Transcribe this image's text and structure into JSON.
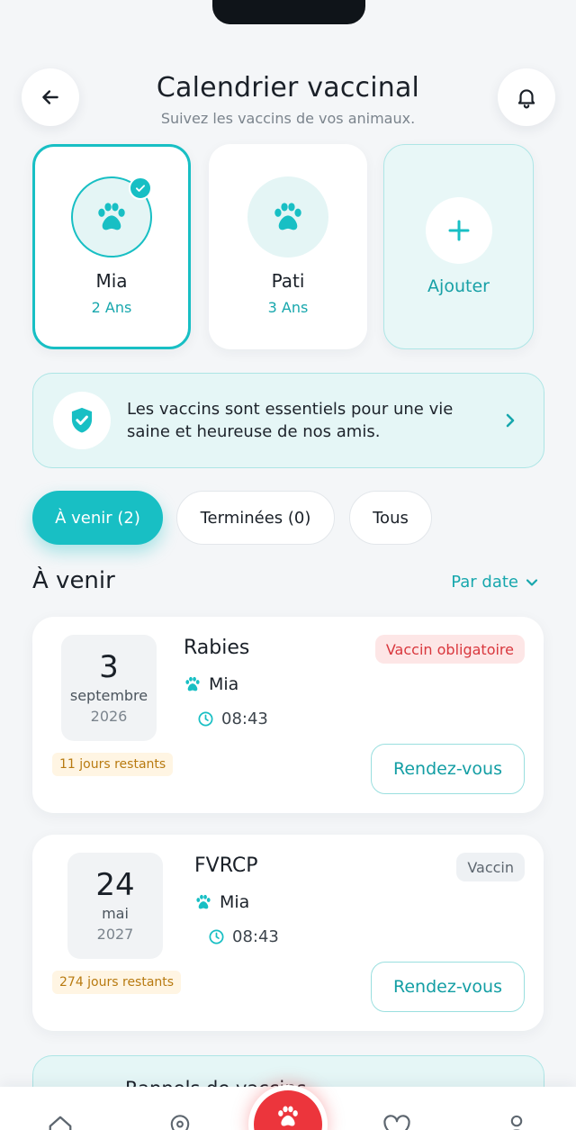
{
  "header": {
    "title": "Calendrier vaccinal",
    "subtitle": "Suivez les vaccins de vos animaux."
  },
  "pets": [
    {
      "name": "Mia",
      "age": "2 Ans",
      "selected": true
    },
    {
      "name": "Pati",
      "age": "3 Ans",
      "selected": false
    }
  ],
  "add_pet": {
    "label": "Ajouter"
  },
  "banner": {
    "text": "Les vaccins sont essentiels pour une vie saine et heureuse de nos amis."
  },
  "tabs": [
    {
      "label": "À venir (2)",
      "active": true
    },
    {
      "label": "Terminées (0)",
      "active": false
    },
    {
      "label": "Tous",
      "active": false
    }
  ],
  "section": {
    "title": "À venir",
    "sort_label": "Par date"
  },
  "vaccines": [
    {
      "day": "3",
      "month": "septembre",
      "year": "2026",
      "days_left": "11 jours restants",
      "name": "Rabies",
      "pet": "Mia",
      "time": "08:43",
      "badge": "Vaccin obligatoire",
      "badge_type": "required",
      "action": "Rendez-vous"
    },
    {
      "day": "24",
      "month": "mai",
      "year": "2027",
      "days_left": "274 jours restants",
      "name": "FVRCP",
      "pet": "Mia",
      "time": "08:43",
      "badge": "Vaccin",
      "badge_type": "normal",
      "action": "Rendez-vous"
    }
  ],
  "teaser": {
    "title": "Rappels de vaccins"
  },
  "icons": {
    "back": "arrow-left-icon",
    "notifications": "bell-icon",
    "pet": "paw-icon",
    "check": "check-icon",
    "add": "plus-icon",
    "shield": "shield-check-icon",
    "chevron": "chevron-right-icon",
    "sort": "chevron-down-icon",
    "time": "clock-icon",
    "nav_home": "home-icon",
    "nav_location": "location-pin-icon",
    "nav_favorites": "heart-icon",
    "nav_profile": "user-icon"
  },
  "colors": {
    "accent": "#18bfc4",
    "accent_text": "#17a7ad",
    "danger": "#ec353c",
    "warning_text": "#b87a10",
    "background": "#f4f6f8"
  }
}
